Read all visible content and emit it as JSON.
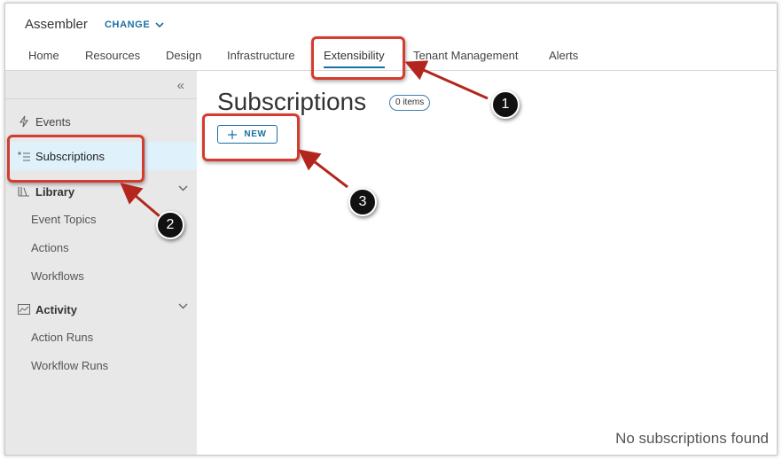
{
  "header": {
    "app_title": "Assembler",
    "change_label": "CHANGE"
  },
  "tabs": [
    "Home",
    "Resources",
    "Design",
    "Infrastructure",
    "Extensibility",
    "Tenant Management",
    "Alerts"
  ],
  "active_tab": "Extensibility",
  "sidebar": {
    "events": "Events",
    "subscriptions": "Subscriptions",
    "library": {
      "label": "Library",
      "items": [
        "Event Topics",
        "Actions",
        "Workflows"
      ]
    },
    "activity": {
      "label": "Activity",
      "items": [
        "Action Runs",
        "Workflow Runs"
      ]
    }
  },
  "main": {
    "title": "Subscriptions",
    "count_badge": "0 items",
    "new_label": "NEW",
    "empty_message": "No subscriptions found"
  },
  "annotations": {
    "steps": [
      "1",
      "2",
      "3"
    ],
    "highlight_color": "#d43c2f",
    "accent_color": "#1b6fa0"
  }
}
